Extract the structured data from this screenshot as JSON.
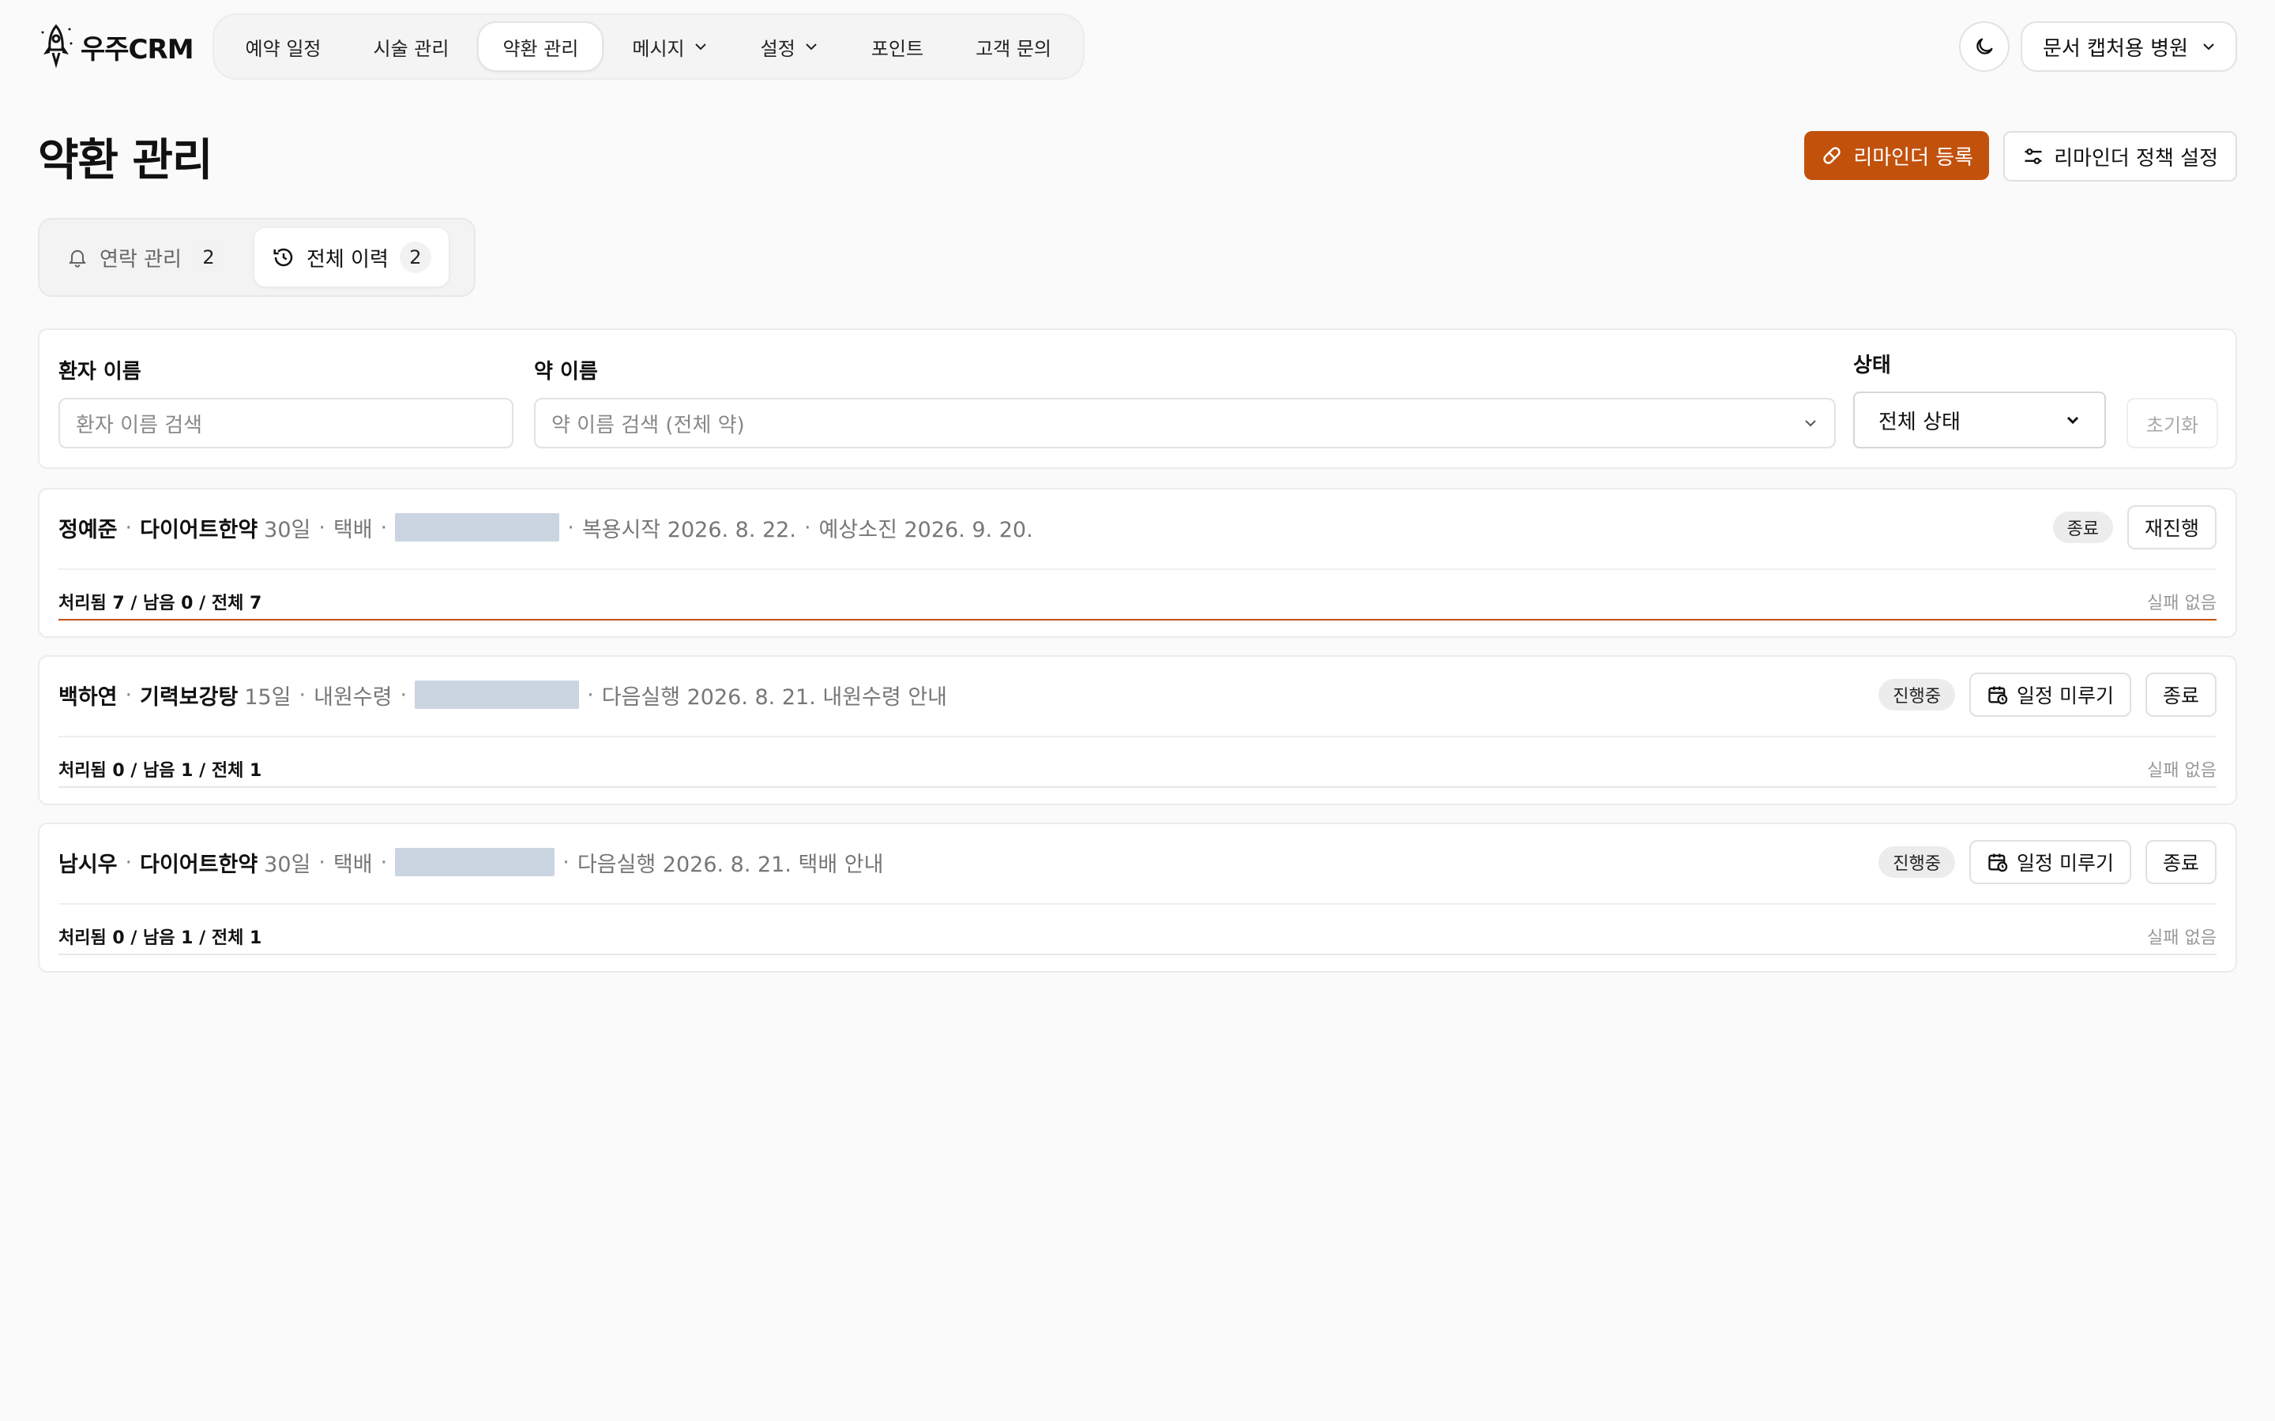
{
  "app": {
    "logo_text": "우주CRM"
  },
  "nav": [
    {
      "label": "예약 일정",
      "active": false,
      "dropdown": false
    },
    {
      "label": "시술 관리",
      "active": false,
      "dropdown": false
    },
    {
      "label": "약환 관리",
      "active": true,
      "dropdown": false
    },
    {
      "label": "메시지",
      "active": false,
      "dropdown": true
    },
    {
      "label": "설정",
      "active": false,
      "dropdown": true
    },
    {
      "label": "포인트",
      "active": false,
      "dropdown": false
    },
    {
      "label": "고객 문의",
      "active": false,
      "dropdown": false
    }
  ],
  "header": {
    "clinic_name": "문서 캡처용 병원"
  },
  "page": {
    "title": "약환 관리",
    "register_button": "리마인더 등록",
    "policy_button": "리마인더 정책 설정"
  },
  "tabs": [
    {
      "label": "연락 관리",
      "count": "2",
      "active": false
    },
    {
      "label": "전체 이력",
      "count": "2",
      "active": true
    }
  ],
  "filters": {
    "patient_label": "환자 이름",
    "patient_placeholder": "환자 이름 검색",
    "medicine_label": "약 이름",
    "medicine_placeholder": "약 이름 검색 (전체 약)",
    "status_label": "상태",
    "status_value": "전체 상태",
    "reset_label": "초기화"
  },
  "rows": [
    {
      "patient": "정예준",
      "medicine": "다이어트한약",
      "days": "30일",
      "method": "택배",
      "detail": "복용시작 2026. 8. 22.",
      "detail2": "예상소진 2026. 9. 20.",
      "badge": "종료",
      "buttons": [
        "재진행"
      ],
      "stats": "처리됨 7 / 남음 0 / 전체 7",
      "fail": "실패 없음",
      "progress": 1.0
    },
    {
      "patient": "백하연",
      "medicine": "기력보강탕",
      "days": "15일",
      "method": "내원수령",
      "detail": "다음실행 2026. 8. 21. 내원수령 안내",
      "detail2": "",
      "badge": "진행중",
      "buttons": [
        "일정 미루기",
        "종료"
      ],
      "stats": "처리됨 0 / 남음 1 / 전체 1",
      "fail": "실패 없음",
      "progress": 0.0
    },
    {
      "patient": "남시우",
      "medicine": "다이어트한약",
      "days": "30일",
      "method": "택배",
      "detail": "다음실행 2026. 8. 21. 택배 안내",
      "detail2": "",
      "badge": "진행중",
      "buttons": [
        "일정 미루기",
        "종료"
      ],
      "stats": "처리됨 0 / 남음 1 / 전체 1",
      "fail": "실패 없음",
      "progress": 0.0
    }
  ],
  "colors": {
    "accent": "#c2510c",
    "masked": "#cbd5e1",
    "badge_bg": "#ececec"
  }
}
